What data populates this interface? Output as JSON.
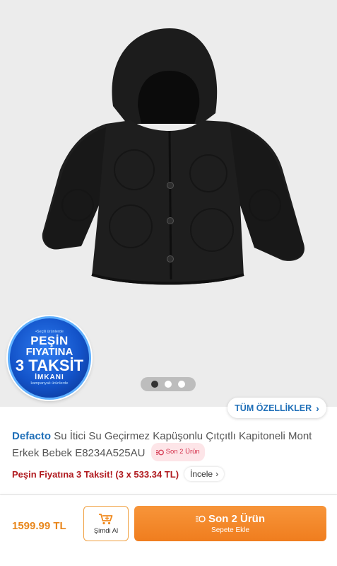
{
  "gallery": {
    "badge": {
      "tiny_text": "•Seçili ürünlerde",
      "line1": "PEŞİN",
      "line2": "FIYATINA",
      "line3": "3 TAKSİT",
      "line4": "İMKANI",
      "tiny_bottom": "kampanyalı ürünlerde"
    },
    "dots_count": 3,
    "active_dot": 1
  },
  "features_button": {
    "label": "TÜM ÖZELLİKLER",
    "icon": "chevron-right-icon"
  },
  "product": {
    "brand": "Defacto",
    "title": "Su İtici Su Geçirmez Kapüşonlu Çıtçıtlı Kapitoneli Mont Erkek Bebek E8234A525AU",
    "stock_tag": "Son 2 Ürün",
    "stock_icon": "stock-alert-icon"
  },
  "installment": {
    "text": "Peşin Fiyatına 3 Taksit! (3 x 533.34 TL)",
    "link_label": "İncele",
    "link_icon": "chevron-right-icon"
  },
  "bottom_bar": {
    "price": "1599.99 TL",
    "buy_now_label": "Şimdi Al",
    "buy_now_icon": "cart-icon",
    "add_to_cart_main": "Son 2 Ürün",
    "add_to_cart_sub": "Sepete Ekle",
    "add_to_cart_icon": "stock-alert-icon"
  },
  "colors": {
    "brand_blue": "#1f6fb8",
    "price_orange": "#e8861b",
    "cta_orange": "#f07d1e",
    "installment_red": "#b0191e",
    "stock_pink": "#fde5e8"
  }
}
